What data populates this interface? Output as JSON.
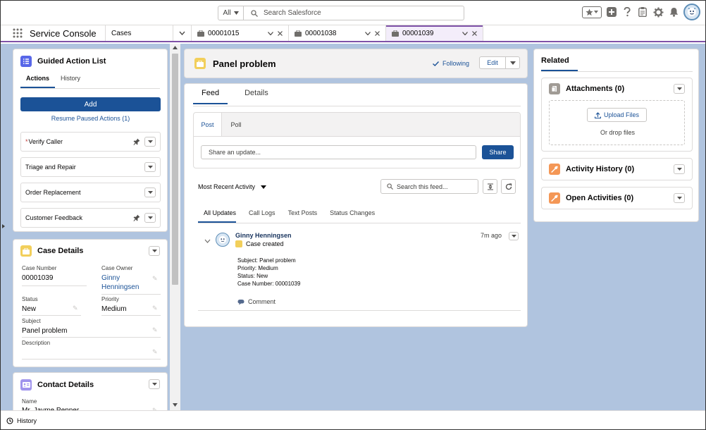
{
  "header": {
    "search_scope": "All",
    "search_placeholder": "Search Salesforce"
  },
  "tabbar": {
    "app_name": "Service Console",
    "object_tab": "Cases",
    "tabs": [
      {
        "label": "00001015"
      },
      {
        "label": "00001038"
      },
      {
        "label": "00001039"
      }
    ]
  },
  "guided": {
    "title": "Guided Action List",
    "tab_actions": "Actions",
    "tab_history": "History",
    "add_label": "Add",
    "resume_label": "Resume Paused Actions (1)",
    "items": [
      {
        "label": "Verify Caller",
        "required": "*"
      },
      {
        "label": "Triage and Repair"
      },
      {
        "label": "Order Replacement"
      },
      {
        "label": "Customer Feedback"
      }
    ]
  },
  "case_details": {
    "title": "Case Details",
    "case_number_label": "Case Number",
    "case_number": "00001039",
    "owner_label": "Case Owner",
    "owner_first": "Ginny",
    "owner_last": "Henningsen",
    "status_label": "Status",
    "status": "New",
    "priority_label": "Priority",
    "priority": "Medium",
    "subject_label": "Subject",
    "subject": "Panel problem",
    "description_label": "Description"
  },
  "contact_details": {
    "title": "Contact Details",
    "name_label": "Name",
    "name": "Mr. Jayme Pepper"
  },
  "record": {
    "title": "Panel problem",
    "following_label": "Following",
    "edit_label": "Edit"
  },
  "feed": {
    "tab_feed": "Feed",
    "tab_details": "Details",
    "pub_post": "Post",
    "pub_poll": "Poll",
    "share_placeholder": "Share an update...",
    "share_label": "Share",
    "sort_label": "Most Recent Activity",
    "search_placeholder": "Search this feed...",
    "update_tabs": [
      "All Updates",
      "Call Logs",
      "Text Posts",
      "Status Changes"
    ],
    "item": {
      "author": "Ginny Henningsen",
      "time": "7m ago",
      "action": "Case created",
      "subject_line": "Subject: Panel problem",
      "priority_line": "Priority: Medium",
      "status_line": "Status: New",
      "number_line": "Case Number: 00001039",
      "comment_label": "Comment"
    }
  },
  "related": {
    "tab_label": "Related",
    "attachments_title": "Attachments (0)",
    "upload_label": "Upload Files",
    "drop_label": "Or drop files",
    "activity_title": "Activity History (0)",
    "open_title": "Open Activities (0)"
  },
  "footer": {
    "history_label": "History"
  },
  "colors": {
    "brand": "#1b5297",
    "tab_accent": "#7f52a8",
    "workspace_bg": "#b0c4df",
    "guided_icon": "#5867e8",
    "case_icon": "#f2cf5b",
    "contact_icon": "#a094ed",
    "related_icon": "#f49756"
  }
}
